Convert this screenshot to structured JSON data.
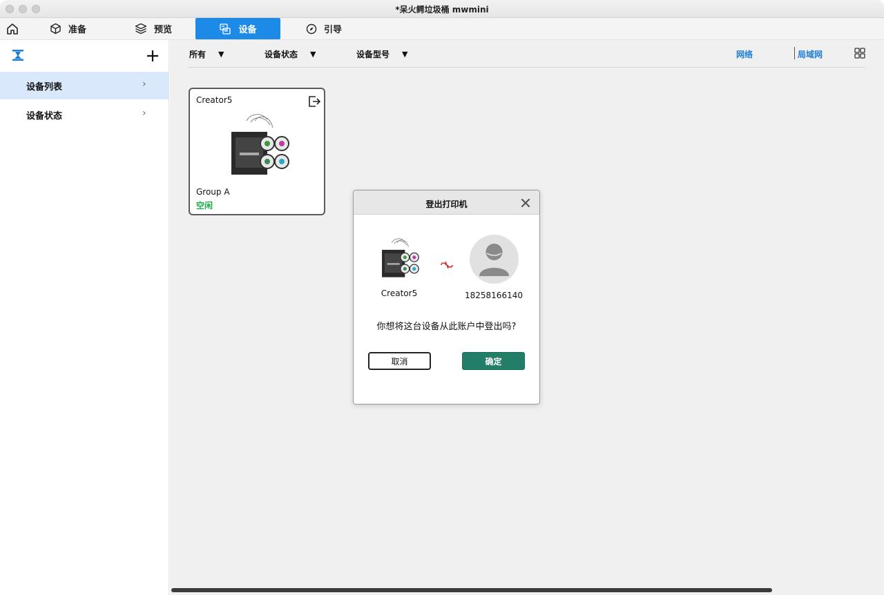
{
  "window": {
    "title": "*呆火鳄垃圾桶 mwmini"
  },
  "tabs": [
    {
      "label": "准备",
      "icon": "cube-icon"
    },
    {
      "label": "预览",
      "icon": "layers-icon"
    },
    {
      "label": "设备",
      "icon": "device-icon",
      "active": true
    },
    {
      "label": "引导",
      "icon": "compass-icon"
    }
  ],
  "sidebar": {
    "items": [
      {
        "label": "设备列表",
        "active": true
      },
      {
        "label": "设备状态",
        "active": false
      }
    ]
  },
  "filters": {
    "all": "所有",
    "status": "设备状态",
    "model": "设备型号",
    "network": "网络",
    "lan": "局域网"
  },
  "device_card": {
    "name": "Creator5",
    "group": "Group A",
    "status": "空闲",
    "status_color": "#1eaa4a"
  },
  "dialog": {
    "title": "登出打印机",
    "printer_name": "Creator5",
    "account": "18258166140",
    "message": "你想将这台设备从此账户中登出吗?",
    "cancel_label": "取消",
    "ok_label": "确定",
    "ok_color": "#237e68"
  },
  "colors": {
    "accent": "#1c8ae6",
    "link": "#1c7ed6"
  }
}
